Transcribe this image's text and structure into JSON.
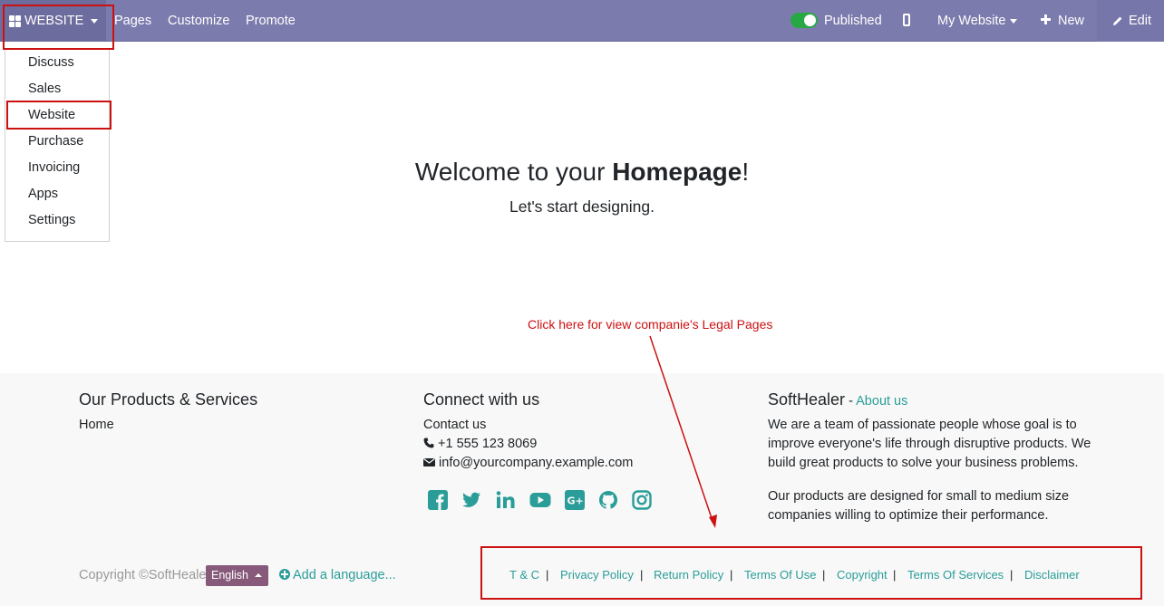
{
  "navbar": {
    "app_menu_label": "WEBSITE",
    "links": [
      "Pages",
      "Customize",
      "Promote"
    ],
    "published_label": "Published",
    "website_selector": "My Website",
    "new_label": "New",
    "edit_label": "Edit"
  },
  "app_dropdown": {
    "items": [
      "Discuss",
      "Sales",
      "Website",
      "Purchase",
      "Invoicing",
      "Apps",
      "Settings"
    ]
  },
  "hero": {
    "title_prefix": "Welcome to your ",
    "title_bold": "Homepage",
    "title_suffix": "!",
    "subtitle": "Let's start designing."
  },
  "annotation": {
    "callout": "Click here for  view companie's Legal Pages",
    "color": "#cc1111"
  },
  "footer": {
    "products": {
      "title": "Our Products & Services",
      "home_link": "Home"
    },
    "connect": {
      "title": "Connect with us",
      "contact_link": "Contact us",
      "phone": "+1 555 123 8069",
      "email": "info@yourcompany.example.com",
      "social_icons": [
        "facebook-icon",
        "twitter-icon",
        "linkedin-icon",
        "youtube-icon",
        "google-plus-icon",
        "github-icon",
        "instagram-icon"
      ]
    },
    "about": {
      "title": "SoftHealer",
      "title_sep": " - ",
      "about_link": "About us",
      "para1": "We are a team of passionate people whose goal is to improve everyone's life through disruptive products. We build great products to solve your business problems.",
      "para2": "Our products are designed for small to medium size companies willing to optimize their performance."
    },
    "copyright": "Copyright ©SoftHealer",
    "language": "English",
    "add_language": "Add a language...",
    "legal_links": [
      "T & C",
      "Privacy Policy",
      "Return Policy",
      "Terms Of Use",
      "Copyright",
      "Terms Of Services",
      "Disclaimer"
    ],
    "separator": "|"
  },
  "colors": {
    "navbar": "#7c7bad",
    "link": "#2a9d98",
    "language_button": "#875a7b",
    "toggle_on": "#28a745"
  }
}
